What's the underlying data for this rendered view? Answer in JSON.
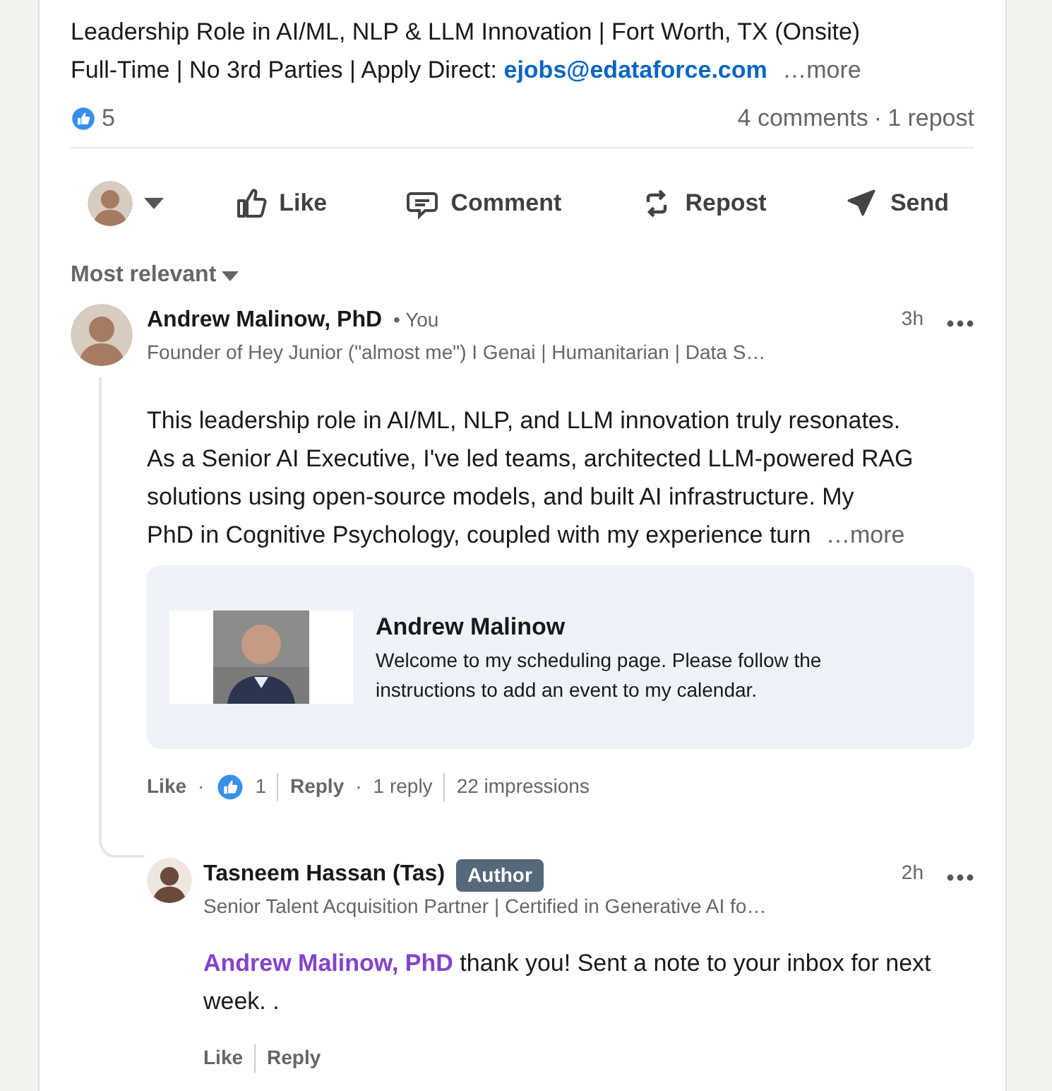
{
  "post": {
    "text_lines": [
      "Leadership Role in AI/ML, NLP & LLM Innovation | Fort Worth, TX (Onsite)",
      "Full-Time | No 3rd Parties | Apply Direct:"
    ],
    "email": "ejobs@edataforce.com",
    "more": "…more"
  },
  "social": {
    "reaction_count": "5",
    "comments": "4 comments",
    "separator": "·",
    "reposts": "1 repost"
  },
  "actions": [
    {
      "kind": "like",
      "label": "Like"
    },
    {
      "kind": "comment",
      "label": "Comment"
    },
    {
      "kind": "repost",
      "label": "Repost"
    },
    {
      "kind": "send",
      "label": "Send"
    }
  ],
  "sort": {
    "label": "Most relevant"
  },
  "comment": {
    "author": "Andrew Malinow, PhD",
    "you": "• You",
    "headline": "Founder of Hey Junior (\"almost me\") I Genai | Humanitarian | Data S…",
    "time": "3h",
    "body_lines": [
      "This leadership role in AI/ML, NLP, and LLM innovation truly resonates.",
      "As a Senior AI Executive, I've led teams, architected LLM-powered RAG",
      "solutions using open-source models, and built AI infrastructure. My",
      "PhD in Cognitive Psychology, coupled with my experience turn"
    ],
    "more": "…more",
    "preview": {
      "kind": "picture",
      "title": "Andrew Malinow",
      "description": "Welcome to my scheduling page. Please follow the instructions to add an event to my calendar."
    },
    "like": "Like",
    "separator": "·",
    "reaction_count": "1",
    "reply": "Reply",
    "replies": "1 reply",
    "impressions": "22 impressions"
  },
  "reply": {
    "author": "Tasneem Hassan (Tas)",
    "badge": "Author",
    "headline": "Senior Talent Acquisition Partner | Certified in Generative AI fo…",
    "time": "2h",
    "mention": "Andrew Malinow, PhD",
    "text": " thank you! Sent a note to your inbox for next week. .",
    "like": "Like",
    "reply": "Reply"
  }
}
